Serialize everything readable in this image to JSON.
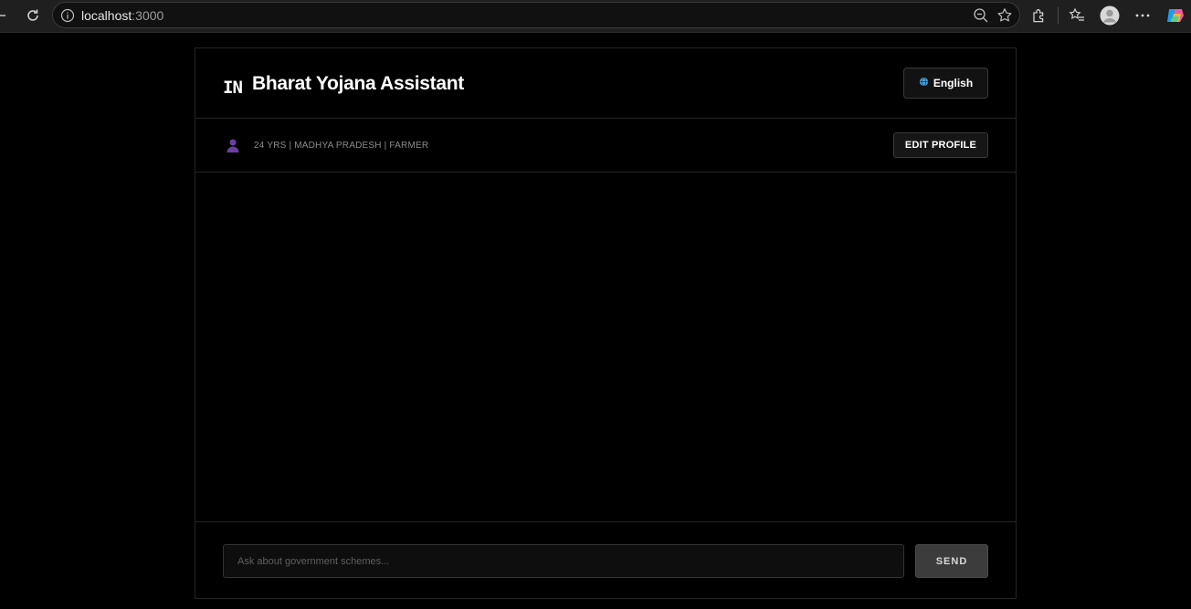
{
  "browser": {
    "url_host": "localhost",
    "url_port": ":3000"
  },
  "app": {
    "flag_code": "IN",
    "title": "Bharat Yojana Assistant",
    "language_label": "English"
  },
  "profile": {
    "summary": "24 YRS | MADHYA PRADESH | FARMER",
    "edit_label": "EDIT PROFILE"
  },
  "composer": {
    "placeholder": "Ask about government schemes...",
    "send_label": "SEND"
  },
  "colors": {
    "background": "#000000",
    "person_icon": "#6b3fa0",
    "globe_icon": "#4aa3e0"
  }
}
